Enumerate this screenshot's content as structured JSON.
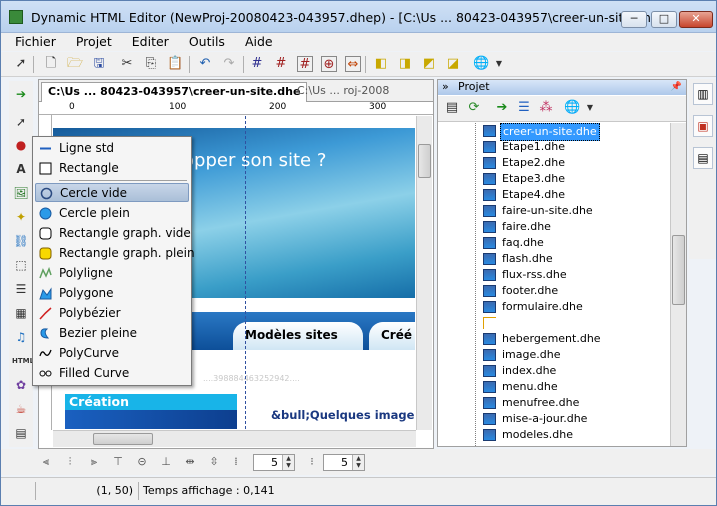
{
  "window": {
    "title": "Dynamic HTML Editor (NewProj-20080423-043957.dhep) - [C:\\Us ... 80423-043957\\creer-un-site.dhe]",
    "min_label": "─",
    "max_label": "□",
    "close_label": "✕"
  },
  "menu": [
    "Fichier",
    "Projet",
    "Editer",
    "Outils",
    "Aide"
  ],
  "tabs": {
    "active": "C:\\Us ... 80423-043957\\creer-un-site.dhe",
    "inactive": "C:\\Us ... roj-2008"
  },
  "ruler": {
    "m0": "0",
    "m100": "100",
    "m200": "200",
    "m300": "300"
  },
  "canvas": {
    "banner_text": "opper son site ?",
    "nav_tab1": "Modèles sites",
    "nav_tab2": "Créé",
    "creation": "Création",
    "bullet": "&bull;Quelques image",
    "faint": "....398884463252942...."
  },
  "shape_menu": [
    {
      "label": "Ligne std",
      "icon": "line-icon"
    },
    {
      "label": "Rectangle",
      "icon": "rectangle-icon"
    },
    {
      "label": "Cercle vide",
      "icon": "circle-empty-icon"
    },
    {
      "label": "Cercle plein",
      "icon": "circle-filled-icon"
    },
    {
      "label": "Rectangle graph. vide",
      "icon": "rect-graph-empty-icon"
    },
    {
      "label": "Rectangle graph. plein",
      "icon": "rect-graph-filled-icon"
    },
    {
      "label": "Polyligne",
      "icon": "polyline-icon"
    },
    {
      "label": "Polygone",
      "icon": "polygon-icon"
    },
    {
      "label": "Polybézier",
      "icon": "polybezier-icon"
    },
    {
      "label": "Bezier pleine",
      "icon": "bezier-filled-icon"
    },
    {
      "label": "PolyCurve",
      "icon": "polycurve-icon"
    },
    {
      "label": "Filled Curve",
      "icon": "filled-curve-icon"
    }
  ],
  "project_panel": {
    "title": "Projet",
    "pin": "📌",
    "files": [
      "creer-un-site.dhe",
      "Etape1.dhe",
      "Etape2.dhe",
      "Etape3.dhe",
      "Etape4.dhe",
      "faire-un-site.dhe",
      "faire.dhe",
      "faq.dhe",
      "flash.dhe",
      "flux-rss.dhe",
      "footer.dhe",
      "formulaire.dhe",
      "",
      "hebergement.dhe",
      "image.dhe",
      "index.dhe",
      "menu.dhe",
      "menufree.dhe",
      "mise-a-jour.dhe",
      "modeles.dhe"
    ]
  },
  "bottom": {
    "spin1": "5",
    "spin2": "5"
  },
  "status": {
    "coords": "(1, 50)",
    "time": "Temps affichage : 0,141"
  }
}
